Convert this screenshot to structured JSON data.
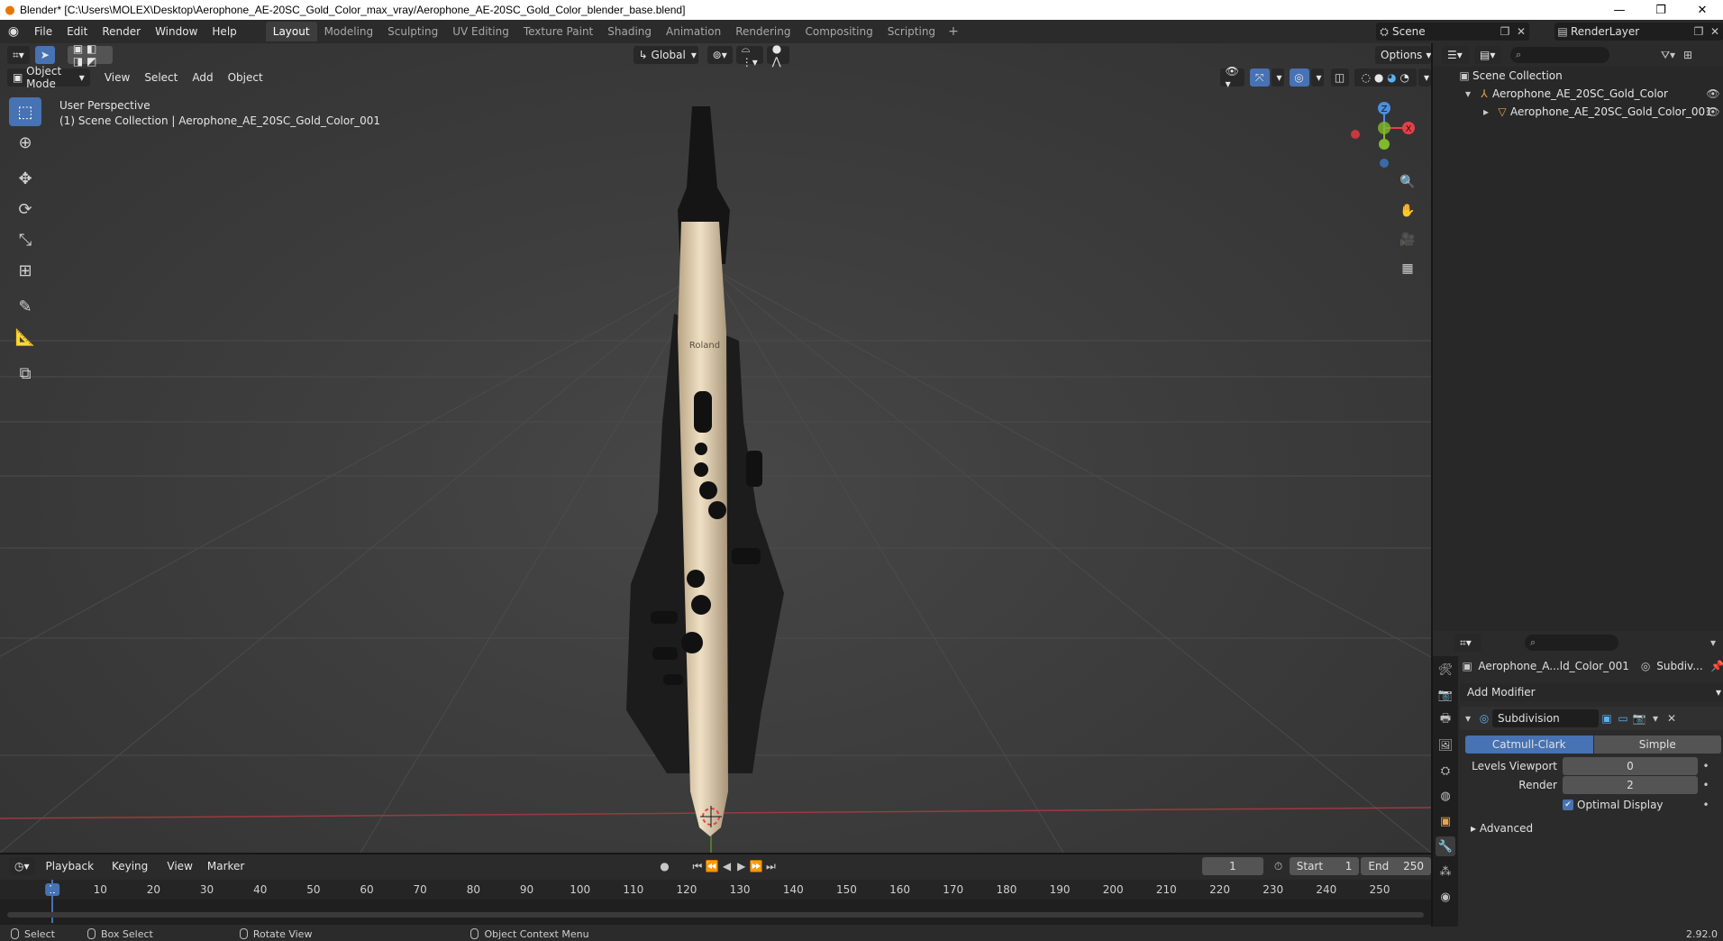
{
  "window": {
    "title": "Blender* [C:\\Users\\MOLEX\\Desktop\\Aerophone_AE-20SC_Gold_Color_max_vray/Aerophone_AE-20SC_Gold_Color_blender_base.blend]",
    "minimize_glyph": "—",
    "maximize_glyph": "❐",
    "close_glyph": "✕"
  },
  "menu": [
    "File",
    "Edit",
    "Render",
    "Window",
    "Help"
  ],
  "workspaces": [
    "Layout",
    "Modeling",
    "Sculpting",
    "UV Editing",
    "Texture Paint",
    "Shading",
    "Animation",
    "Rendering",
    "Compositing",
    "Scripting"
  ],
  "active_workspace": "Layout",
  "scene": {
    "name": "Scene",
    "render_layer": "RenderLayer"
  },
  "viewport": {
    "orientation": "Global",
    "options_label": "Options",
    "mode": "Object Mode",
    "header_menus": [
      "View",
      "Select",
      "Add",
      "Object"
    ],
    "perspective_label": "User Perspective",
    "collection_label": "(1) Scene Collection | Aerophone_AE_20SC_Gold_Color_001",
    "gizmo_axes": {
      "x": "X",
      "y": "Y",
      "z": "Z"
    },
    "logo_text": "Roland"
  },
  "outliner": {
    "root": "Scene Collection",
    "items": [
      {
        "label": "Aerophone_AE_20SC_Gold_Color"
      },
      {
        "label": "Aerophone_AE_20SC_Gold_Color_001"
      }
    ]
  },
  "properties": {
    "object_name": "Aerophone_A...ld_Color_001",
    "modifier_short": "Subdiv...",
    "add_modifier": "Add Modifier",
    "modifier_name": "Subdivision",
    "type_options": [
      "Catmull-Clark",
      "Simple"
    ],
    "active_type": "Catmull-Clark",
    "levels_viewport_label": "Levels Viewport",
    "levels_viewport": "0",
    "render_label": "Render",
    "render_value": "2",
    "optimal_display_label": "Optimal Display",
    "optimal_display": true,
    "advanced_label": "Advanced"
  },
  "timeline": {
    "menus": [
      "Playback",
      "Keying",
      "View",
      "Marker"
    ],
    "current_frame": "1",
    "start_label": "Start",
    "start": "1",
    "end_label": "End",
    "end": "250",
    "ticks": [
      "1",
      "10",
      "20",
      "30",
      "40",
      "50",
      "60",
      "70",
      "80",
      "90",
      "100",
      "110",
      "120",
      "130",
      "140",
      "150",
      "160",
      "170",
      "180",
      "190",
      "200",
      "210",
      "220",
      "230",
      "240",
      "250"
    ]
  },
  "statusbar": {
    "select": "Select",
    "box_select": "Box Select",
    "rotate_view": "Rotate View",
    "context_menu": "Object Context Menu",
    "version": "2.92.0"
  },
  "colors": {
    "accent": "#4772b3",
    "x_axis": "#e5404a",
    "y_axis": "#7fbb2b",
    "z_axis": "#4d8fdc"
  }
}
